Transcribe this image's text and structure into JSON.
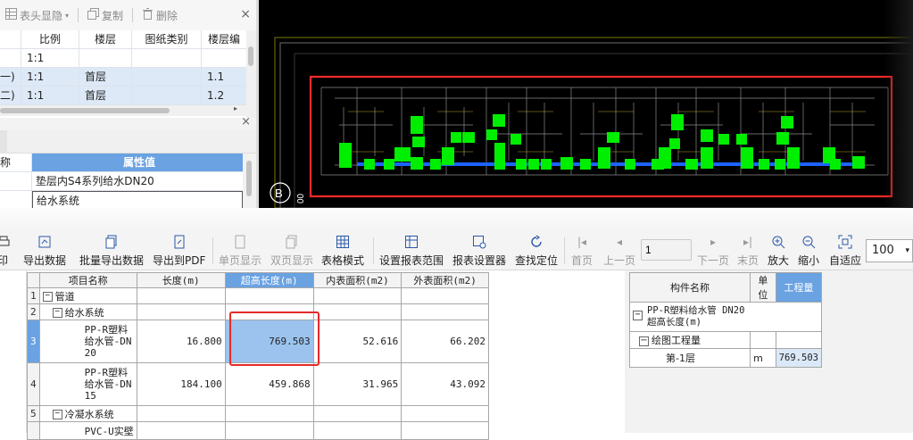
{
  "top_toolbar": {
    "header_display_label": "表头显隐",
    "copy_label": "复制",
    "delete_label": "删除",
    "close_glyph": "×"
  },
  "drawing_list": {
    "columns": [
      "",
      "比例",
      "楼层",
      "图纸类别",
      "楼层编"
    ],
    "rows": [
      {
        "name": "",
        "scale": "1:1",
        "floor": "",
        "category": "",
        "code": ""
      },
      {
        "name": "一)",
        "scale": "1:1",
        "floor": "首层",
        "category": "",
        "code": "1.1"
      },
      {
        "name": "二)",
        "scale": "1:1",
        "floor": "首层",
        "category": "",
        "code": "1.2"
      }
    ]
  },
  "properties": {
    "close_glyph": "×",
    "header_key": "称",
    "header_value": "属性值",
    "rows": [
      {
        "key": "",
        "value": "垫层内S4系列给水DN20"
      },
      {
        "key": "",
        "value": "给水系统"
      }
    ]
  },
  "cad": {
    "axis_label": "B",
    "side_digits": "00",
    "background": "#000000",
    "highlight_color": "#ff2a2a",
    "element_color": "#00ee00",
    "pipe_color": "#1e63ff"
  },
  "toolbar": {
    "print": "印",
    "export_data": "导出数据",
    "batch_export": "批量导出数据",
    "export_pdf": "导出到PDF",
    "single_page": "单页显示",
    "double_page": "双页显示",
    "table_mode": "表格模式",
    "set_range": "设置报表范围",
    "report_settings": "报表设置器",
    "locate": "查找定位",
    "first_page": "首页",
    "prev_page": "上一页",
    "page_value": "1",
    "next_page": "下一页",
    "last_page": "末页",
    "zoom_in": "放大",
    "zoom_out": "缩小",
    "fit": "自适应",
    "zoom_value": "100"
  },
  "report": {
    "columns": [
      "项目名称",
      "长度(m)",
      "超高长度(m)",
      "内表面积(m2)",
      "外表面积(m2)"
    ],
    "rows": [
      {
        "index": "1",
        "name": "管道",
        "level": 0,
        "length": "",
        "over_length": "",
        "inner_area": "",
        "outer_area": ""
      },
      {
        "index": "2",
        "name": "给水系统",
        "level": 1,
        "length": "",
        "over_length": "",
        "inner_area": "",
        "outer_area": ""
      },
      {
        "index": "3",
        "name": "PP-R塑料给水管-DN20",
        "lines": [
          "PP-R塑料",
          "给水管-DN",
          "20"
        ],
        "length": "16.800",
        "over_length": "769.503",
        "inner_area": "52.616",
        "outer_area": "66.202"
      },
      {
        "index": "4",
        "name": "PP-R塑料给水管-DN15",
        "lines": [
          "PP-R塑料",
          "给水管-DN",
          "15"
        ],
        "length": "184.100",
        "over_length": "459.868",
        "inner_area": "31.965",
        "outer_area": "43.092"
      },
      {
        "index": "5",
        "name": "冷凝水系统",
        "level": 1,
        "length": "",
        "over_length": "",
        "inner_area": "",
        "outer_area": ""
      },
      {
        "index": "",
        "name": "PVC-U实壁",
        "length": "",
        "over_length": "",
        "inner_area": "",
        "outer_area": ""
      }
    ]
  },
  "detail": {
    "columns": [
      "构件名称",
      "单位",
      "工程量"
    ],
    "title_line1": "PP-R塑料给水管 DN20",
    "title_line2": "超高长度(m)",
    "group_label": "绘图工程量",
    "floor_label": "第-1层",
    "unit": "m",
    "quantity": "769.503"
  }
}
